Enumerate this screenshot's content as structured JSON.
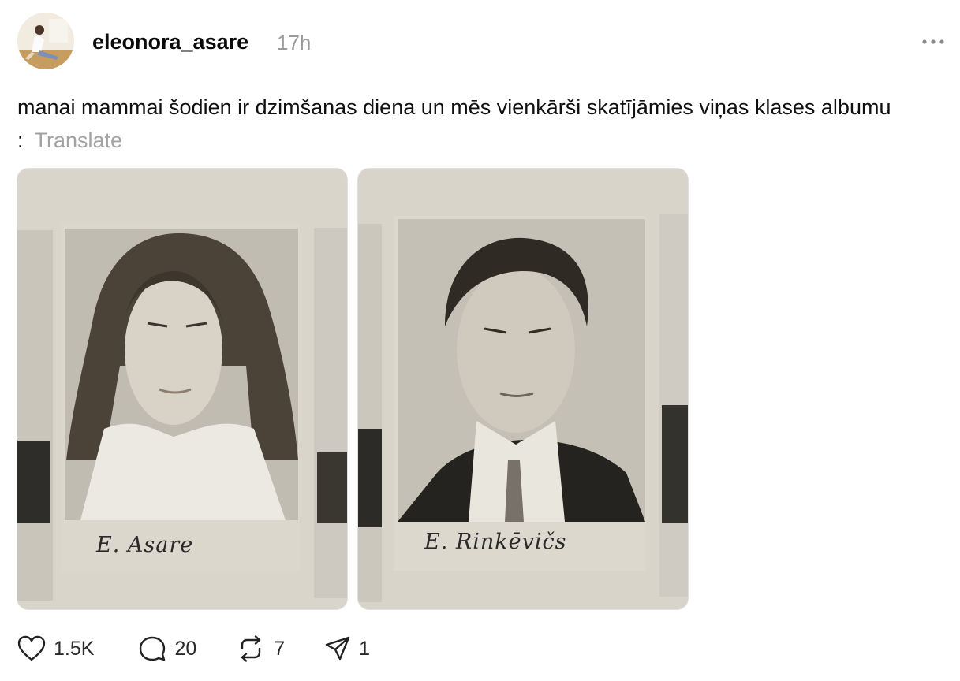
{
  "post": {
    "username": "eleonora_asare",
    "time": "17h",
    "text": "manai mammai šodien ir dzimšanas diena un mēs vienkārši skatījāmies viņas klases albumu :",
    "translate_label": "Translate"
  },
  "photos": [
    {
      "caption": "E. Asare"
    },
    {
      "caption": "E. Rinkēvičs"
    }
  ],
  "actions": {
    "likes": "1.5K",
    "comments": "20",
    "reposts": "7",
    "shares": "1"
  },
  "icons": [
    "avatar",
    "more-icon",
    "heart-icon",
    "comment-icon",
    "repost-icon",
    "share-icon"
  ],
  "colors": {
    "muted": "#9a9a9a",
    "text": "#101010",
    "photo_bg": "#d6d2c8"
  }
}
